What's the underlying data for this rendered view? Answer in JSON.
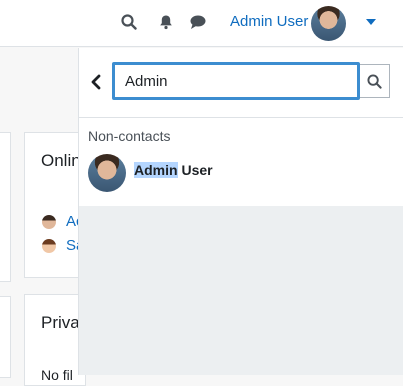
{
  "header": {
    "user_name": "Admin User",
    "icons": [
      "search-icon",
      "bell-icon",
      "chat-icon",
      "chevron-down-icon"
    ]
  },
  "background": {
    "online_title": "Onlin",
    "online_users": [
      "Ac",
      "Sa"
    ],
    "private_title": "Priva",
    "private_text": "No fil"
  },
  "drawer": {
    "search_value": "Admin",
    "section_label": "Non-contacts",
    "result": {
      "highlight": "Admin",
      "rest": " User"
    }
  },
  "colors": {
    "link": "#0f6cbf",
    "search_border": "#3c8dd0",
    "highlight": "#b4d5fe"
  }
}
